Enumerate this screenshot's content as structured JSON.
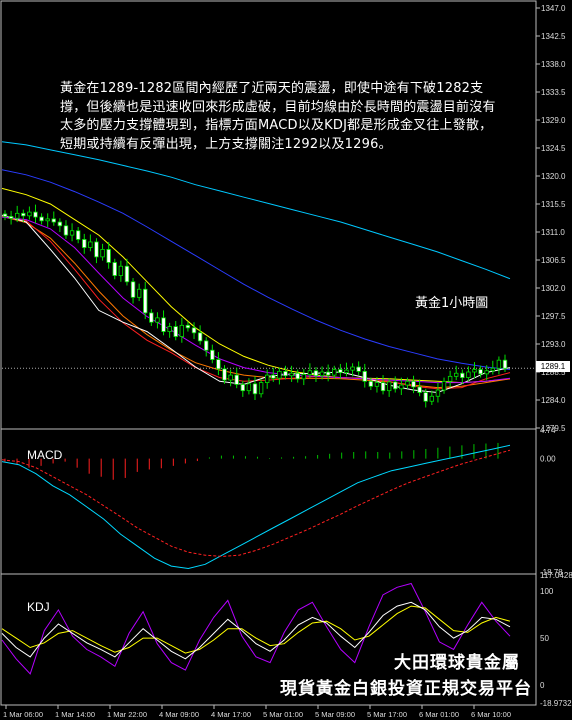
{
  "comment": "黃金在1289-1282區間內經歷了近兩天的震盪，即使中途有下破1282支撐，但後續也是迅速收回來形成虛破，目前均線由於長時間的震盪目前沒有太多的壓力支撐體現到，指標方面MACD以及KDJ都是形成金叉往上發散，短期或持續有反彈出現，上方支撐關注1292以及1296。",
  "timeframe_label": "黃金1小時圖",
  "watermark": {
    "line1": "大田環球貴金屬",
    "line2": "現貨黃金白銀投資正規交易平台"
  },
  "panels": {
    "macd_label": "MACD",
    "kdj_label": "KDJ"
  },
  "current_price": "1289.1",
  "chart_data": {
    "type": "candlestick",
    "symbol": "XAUUSD H1",
    "price_axis": {
      "ticks": [
        "1347.0",
        "1342.5",
        "1338.0",
        "1333.5",
        "1329.0",
        "1324.5",
        "1320.0",
        "1315.5",
        "1311.0",
        "1306.5",
        "1302.0",
        "1297.5",
        "1293.0",
        "1288.5",
        "1284.0",
        "1279.5"
      ],
      "range": [
        1279.5,
        1347.0
      ]
    },
    "macd_axis": {
      "ticks": [
        "4.74",
        "0.00",
        "-18.78"
      ],
      "range": [
        -18.78,
        4.74
      ]
    },
    "kdj_axis": {
      "ticks": [
        "117.0428",
        "100",
        "50",
        "0",
        "-18.9732"
      ],
      "range": [
        -18.9732,
        117.0428
      ]
    },
    "time_axis": [
      "1 Mar 06:00",
      "1 Mar 14:00",
      "1 Mar 22:00",
      "4 Mar 09:00",
      "4 Mar 17:00",
      "5 Mar 01:00",
      "5 Mar 09:00",
      "5 Mar 17:00",
      "6 Mar 01:00",
      "6 Mar 10:00"
    ],
    "close_series": [
      1313.5,
      1313.2,
      1314.0,
      1313.6,
      1314.2,
      1313.4,
      1312.8,
      1313.1,
      1312.6,
      1312.0,
      1310.5,
      1311.2,
      1309.8,
      1308.5,
      1309.4,
      1307.0,
      1308.2,
      1306.1,
      1304.0,
      1305.5,
      1303.0,
      1300.5,
      1301.8,
      1298.0,
      1296.5,
      1297.2,
      1295.0,
      1295.8,
      1294.2,
      1296.0,
      1295.6,
      1294.8,
      1293.5,
      1292.0,
      1290.5,
      1289.0,
      1287.2,
      1288.0,
      1286.5,
      1285.5,
      1286.6,
      1285.0,
      1286.8,
      1288.0,
      1287.5,
      1288.6,
      1287.9,
      1288.3,
      1287.4,
      1288.1,
      1288.7,
      1287.9,
      1288.5,
      1288.0,
      1288.9,
      1288.4,
      1288.8,
      1289.3,
      1288.6,
      1287.0,
      1286.2,
      1286.8,
      1285.5,
      1286.9,
      1285.8,
      1286.4,
      1287.0,
      1286.1,
      1285.2,
      1283.8,
      1284.6,
      1285.6,
      1287.0,
      1287.8,
      1288.3,
      1287.6,
      1288.5,
      1288.9,
      1288.2,
      1288.7,
      1289.1,
      1290.4,
      1289.1
    ],
    "ma_series": [
      {
        "color": "#00c8ff",
        "values": [
          1325.5,
          1325.0,
          1324.2,
          1323.4,
          1322.6,
          1321.7,
          1320.8,
          1319.8,
          1318.6,
          1317.6,
          1316.6,
          1315.6,
          1314.6,
          1313.6,
          1312.6,
          1311.4,
          1310.2,
          1309.0,
          1307.8,
          1306.4,
          1305.0,
          1303.5
        ]
      },
      {
        "color": "#2a3cff",
        "values": [
          1321.0,
          1320.2,
          1319.0,
          1317.5,
          1315.8,
          1314.0,
          1311.8,
          1309.5,
          1307.2,
          1304.9,
          1302.6,
          1300.5,
          1298.6,
          1296.8,
          1295.2,
          1293.8,
          1292.6,
          1291.6,
          1290.6,
          1289.9,
          1289.3,
          1288.9
        ]
      },
      {
        "color": "#ffff00",
        "values": [
          1318.0,
          1317.0,
          1315.5,
          1313.0,
          1310.5,
          1307.0,
          1303.0,
          1299.0,
          1295.6,
          1293.0,
          1291.0,
          1289.6,
          1288.6,
          1288.0,
          1287.6,
          1287.5,
          1287.4,
          1287.2,
          1287.0,
          1286.8,
          1287.0,
          1287.4
        ]
      },
      {
        "color": "#ff7800",
        "values": [
          1313.5,
          1312.5,
          1310.0,
          1306.0,
          1301.5,
          1297.5,
          1294.5,
          1292.0,
          1290.0,
          1288.8,
          1288.0,
          1287.6,
          1287.4,
          1287.5,
          1287.4,
          1287.2,
          1286.9,
          1286.4,
          1286.0,
          1286.2,
          1286.8,
          1287.4
        ]
      },
      {
        "color": "#ff2020",
        "values": [
          1313.6,
          1312.8,
          1309.5,
          1305.0,
          1300.2,
          1296.4,
          1293.6,
          1291.6,
          1289.2,
          1287.6,
          1287.0,
          1287.2,
          1287.5,
          1287.8,
          1287.6,
          1287.4,
          1287.0,
          1286.2,
          1285.8,
          1286.0,
          1287.4,
          1288.4
        ]
      },
      {
        "color": "#ffffff",
        "values": [
          1313.7,
          1312.6,
          1308.2,
          1303.6,
          1298.4,
          1296.5,
          1295.0,
          1292.2,
          1289.3,
          1287.0,
          1286.5,
          1287.8,
          1288.2,
          1288.3,
          1288.5,
          1287.6,
          1286.4,
          1285.6,
          1285.2,
          1286.6,
          1288.4,
          1289.2
        ]
      },
      {
        "color": "#b400ff",
        "values": [
          1313.4,
          1313.0,
          1311.5,
          1308.5,
          1304.4,
          1300.4,
          1297.4,
          1295.2,
          1292.8,
          1290.6,
          1289.2,
          1288.4,
          1288.0,
          1287.8,
          1287.6,
          1287.4,
          1287.2,
          1287.0,
          1286.8,
          1286.8,
          1287.0,
          1287.5
        ]
      }
    ],
    "macd": {
      "histogram": [
        -0.5,
        -1.0,
        -1.5,
        -1.2,
        -0.8,
        -0.5,
        -1.5,
        -2.5,
        -3.0,
        -3.5,
        -3.2,
        -2.2,
        -1.8,
        -1.6,
        -1.2,
        -0.8,
        -0.4,
        0.2,
        0.5,
        0.5,
        0.4,
        0.3,
        0.1,
        0.2,
        0.3,
        0.4,
        0.6,
        0.8,
        1.0,
        1.1,
        1.2,
        1.1,
        1.0,
        1.2,
        1.4,
        1.6,
        1.8,
        2.0,
        2.2,
        2.4,
        2.5,
        2.6
      ],
      "macd_line": [
        -0.5,
        -1.0,
        -2.5,
        -4.5,
        -6.0,
        -8.0,
        -10.0,
        -12.5,
        -14.5,
        -16.5,
        -17.8,
        -18.2,
        -17.5,
        -16.0,
        -14.5,
        -13.0,
        -11.5,
        -10.0,
        -8.5,
        -7.0,
        -5.5,
        -4.0,
        -3.0,
        -2.0,
        -1.4,
        -0.8,
        -0.2,
        0.4,
        1.0,
        1.6,
        2.2
      ],
      "signal_line": [
        -0.2,
        -0.5,
        -1.5,
        -3.0,
        -4.5,
        -6.0,
        -7.8,
        -9.6,
        -11.5,
        -13.0,
        -14.5,
        -15.5,
        -16.0,
        -16.2,
        -16.0,
        -15.2,
        -14.2,
        -13.0,
        -11.8,
        -10.5,
        -9.2,
        -7.8,
        -6.5,
        -5.2,
        -4.0,
        -3.0,
        -2.0,
        -1.0,
        -0.2,
        0.6,
        1.4
      ]
    },
    "kdj": {
      "k": [
        55,
        40,
        30,
        50,
        65,
        55,
        45,
        38,
        30,
        45,
        60,
        48,
        36,
        28,
        40,
        55,
        70,
        58,
        44,
        36,
        48,
        64,
        72,
        66,
        52,
        40,
        56,
        74,
        84,
        88,
        80,
        62,
        50,
        58,
        72,
        70,
        62
      ],
      "d": [
        60,
        50,
        40,
        45,
        55,
        58,
        50,
        42,
        35,
        40,
        50,
        50,
        42,
        34,
        38,
        48,
        60,
        60,
        50,
        42,
        44,
        56,
        66,
        68,
        60,
        48,
        52,
        64,
        76,
        84,
        82,
        70,
        58,
        56,
        66,
        72,
        68
      ],
      "j": [
        48,
        28,
        12,
        58,
        80,
        52,
        38,
        30,
        20,
        55,
        78,
        44,
        24,
        16,
        48,
        72,
        90,
        52,
        30,
        24,
        56,
        80,
        88,
        62,
        38,
        24,
        62,
        96,
        104,
        108,
        78,
        46,
        38,
        64,
        88,
        68,
        52
      ]
    }
  }
}
